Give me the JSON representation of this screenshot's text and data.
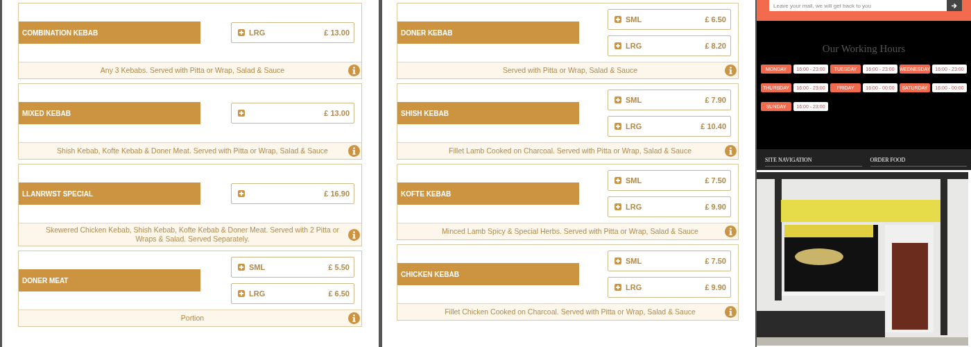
{
  "menu_columns": [
    {
      "items": [
        {
          "name": "COMBINATION KEBAB",
          "options": [
            {
              "size": "LRG",
              "price": "£ 13.00"
            }
          ],
          "description": "Any 3 Kebabs. Served with Pitta or Wrap, Salad & Sauce"
        },
        {
          "name": "MIXED KEBAB",
          "options": [
            {
              "price": "£ 13.00"
            }
          ],
          "description": "Shish Kebab, Kofte Kebab & Doner Meat. Served with Pitta or Wrap, Salad & Sauce"
        },
        {
          "name": "LLANRWST SPECIAL",
          "options": [
            {
              "price": "£ 16.90"
            }
          ],
          "description": "Skewered Chicken Kebab, Shish Kebab, Kofte Kebab & Doner Meat. Served with 2 Pitta or Wraps & Salad. Served Separately."
        },
        {
          "name": "DONER MEAT",
          "options": [
            {
              "size": "SML",
              "price": "£ 5.50"
            },
            {
              "size": "LRG",
              "price": "£ 6.50"
            }
          ],
          "description": "Portion"
        }
      ]
    },
    {
      "items": [
        {
          "name": "DONER KEBAB",
          "options": [
            {
              "size": "SML",
              "price": "£ 6.50"
            },
            {
              "size": "LRG",
              "price": "£ 8.20"
            }
          ],
          "description": "Served with Pitta or Wrap, Salad & Sauce"
        },
        {
          "name": "SHISH KEBAB",
          "options": [
            {
              "size": "SML",
              "price": "£ 7.90"
            },
            {
              "size": "LRG",
              "price": "£ 10.40"
            }
          ],
          "description": "Fillet Lamb Cooked on Charcoal. Served with Pitta or Wrap, Salad & Sauce"
        },
        {
          "name": "KOFTE KEBAB",
          "options": [
            {
              "size": "SML",
              "price": "£ 7.50"
            },
            {
              "size": "LRG",
              "price": "£ 9.90"
            }
          ],
          "description": "Minced Lamb Spicy & Special Herbs. Served with Pitta or Wrap, Salad & Sauce"
        },
        {
          "name": "CHICKEN KEBAB",
          "options": [
            {
              "size": "SML",
              "price": "£ 7.50"
            },
            {
              "size": "LRG",
              "price": "£ 9.90"
            }
          ],
          "description": "Fillet Chicken Cooked on Charcoal. Served with Pitta or Wrap, Salad & Sauce"
        }
      ]
    }
  ],
  "newsletter": {
    "placeholder": "Leave your mail, we will get back to you"
  },
  "working_hours": {
    "title": "Our Working Hours",
    "days": [
      {
        "day": "MONDAY",
        "hours": "16:00 - 23:00"
      },
      {
        "day": "TUESDAY",
        "hours": "16:00 - 23:00"
      },
      {
        "day": "WEDNESDAY",
        "hours": "16:00 - 23:00"
      },
      {
        "day": "THURSDAY",
        "hours": "16:00 - 23:00"
      },
      {
        "day": "FRIDAY",
        "hours": "16:00 - 00:00"
      },
      {
        "day": "SATURDAY",
        "hours": "16:00 - 00:00"
      },
      {
        "day": "SUNDAY",
        "hours": "16:00 - 23:00"
      }
    ]
  },
  "footer": {
    "headings": [
      "SITE NAVIGATION",
      "ORDER FOOD"
    ]
  }
}
